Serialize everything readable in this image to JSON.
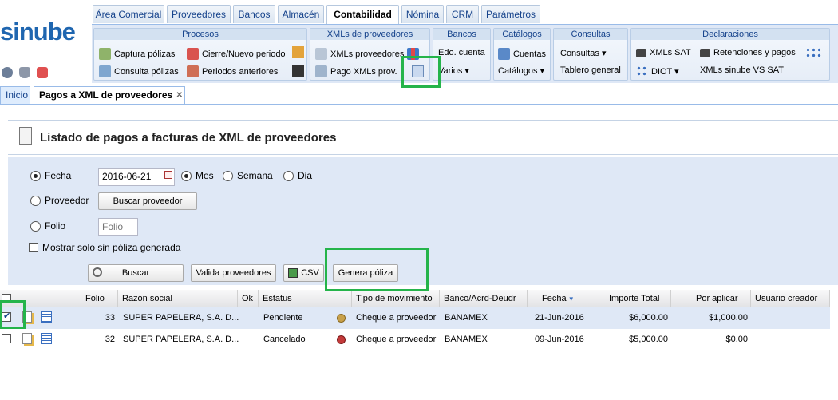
{
  "brand": {
    "logo": "sinube"
  },
  "tabs": [
    "Área Comercial",
    "Proveedores",
    "Bancos",
    "Almacén",
    "Contabilidad",
    "Nómina",
    "CRM",
    "Parámetros"
  ],
  "ribbon": {
    "procesos": {
      "title": "Procesos",
      "items": [
        "Captura pólizas",
        "Cierre/Nuevo periodo",
        "Consulta pólizas",
        "Periodos anteriores"
      ]
    },
    "xmls": {
      "title": "XMLs de proveedores",
      "items": [
        "XMLs proveedores",
        "Pago XMLs prov."
      ]
    },
    "bancos": {
      "title": "Bancos",
      "items": [
        "Edo. cuenta",
        "Varios ▾"
      ]
    },
    "catalogos": {
      "title": "Catálogos",
      "items": [
        "Cuentas",
        "Catálogos ▾"
      ]
    },
    "consultas": {
      "title": "Consultas",
      "items": [
        "Consultas ▾",
        "Tablero general"
      ]
    },
    "declaraciones": {
      "title": "Declaraciones",
      "items": [
        "XMLs SAT",
        "Retenciones y pagos",
        "DIOT ▾",
        "XMLs sinube VS SAT"
      ]
    }
  },
  "subtabs": [
    "Inicio",
    "Pagos a XML de proveedores"
  ],
  "header": {
    "title": "Listado de pagos a facturas de XML de proveedores"
  },
  "form": {
    "fecha_label": "Fecha",
    "fecha_value": "2016-06-21",
    "mes": "Mes",
    "semana": "Semana",
    "dia": "Dia",
    "proveedor_label": "Proveedor",
    "buscar_proveedor": "Buscar proveedor",
    "folio_label": "Folio",
    "folio_placeholder": "Folio",
    "solo_sin_poliza": "Mostrar solo sin póliza generada",
    "buscar": "Buscar",
    "valida": "Valida proveedores",
    "csv": "CSV",
    "genera": "Genera póliza"
  },
  "grid": {
    "columns": [
      "Folio",
      "Razón social",
      "Ok",
      "Estatus",
      "Tipo de movimiento",
      "Banco/Acrd-Deudr",
      "Fecha",
      "Importe Total",
      "Por aplicar",
      "Usuario creador"
    ],
    "rows": [
      {
        "folio": "33",
        "razon": "SUPER PAPELERA, S.A. D...",
        "estatus": "Pendiente",
        "status_color": "#c8a04a",
        "tipo": "Cheque a proveedor",
        "banco": "BANAMEX",
        "fecha": "21-Jun-2016",
        "importe": "$6,000.00",
        "por_aplicar": "$1,000.00",
        "checked": true
      },
      {
        "folio": "32",
        "razon": "SUPER PAPELERA, S.A. D...",
        "estatus": "Cancelado",
        "status_color": "#c33a3a",
        "tipo": "Cheque a proveedor",
        "banco": "BANAMEX",
        "fecha": "09-Jun-2016",
        "importe": "$5,000.00",
        "por_aplicar": "$0.00",
        "checked": false
      }
    ]
  }
}
